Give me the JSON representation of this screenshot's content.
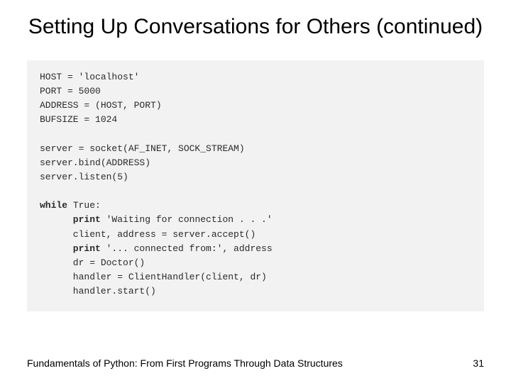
{
  "title": "Setting Up Conversations for Others (continued)",
  "code": {
    "l1a": "HOST = ",
    "l1b": "'localhost'",
    "l2": "PORT = 5000",
    "l3": "ADDRESS = (HOST, PORT)",
    "l4": "BUFSIZE = 1024",
    "blank1": " ",
    "l5": "server = socket(AF_INET, SOCK_STREAM)",
    "l6": "server.bind(ADDRESS)",
    "l7": "server.listen(5)",
    "blank2": " ",
    "l8a": "while",
    "l8b": " True:",
    "l9a": "      print ",
    "l9b": "'Waiting for connection . . .'",
    "l10": "      client, address = server.accept()",
    "l11a": "      print ",
    "l11b": "'... connected from:'",
    "l11c": ", address",
    "l12": "      dr = Doctor()",
    "l13": "      handler = ClientHandler(client, dr)",
    "l14": "      handler.start()"
  },
  "footer": {
    "text": "Fundamentals of Python: From First Programs Through Data Structures",
    "page": "31"
  }
}
